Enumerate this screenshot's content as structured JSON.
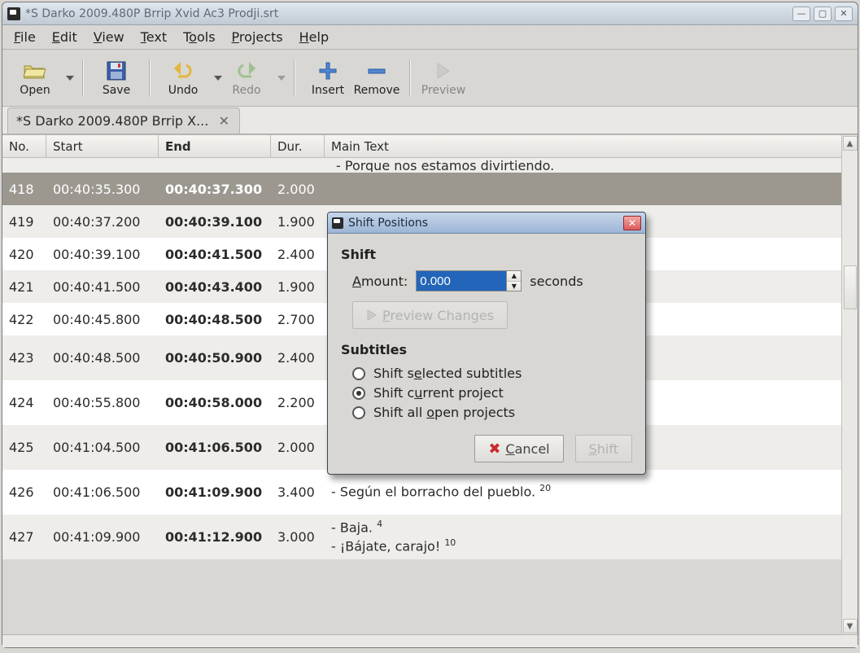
{
  "window": {
    "title": "*S Darko 2009.480P Brrip Xvid Ac3 Prodji.srt"
  },
  "menubar": [
    "File",
    "Edit",
    "View",
    "Text",
    "Tools",
    "Projects",
    "Help"
  ],
  "toolbar": {
    "open": "Open",
    "save": "Save",
    "undo": "Undo",
    "redo": "Redo",
    "insert": "Insert",
    "remove": "Remove",
    "preview": "Preview"
  },
  "doc_tab": {
    "label": "*S Darko 2009.480P Brrip X..."
  },
  "columns": {
    "no": "No.",
    "start": "Start",
    "end": "End",
    "dur": "Dur.",
    "main": "Main Text"
  },
  "cutoff_text": "- Porque nos estamos divirtiendo.",
  "rows": [
    {
      "no": "418",
      "start": "00:40:35.300",
      "end": "00:40:37.300",
      "dur": "2.000",
      "text": "",
      "selected": true
    },
    {
      "no": "419",
      "start": "00:40:37.200",
      "end": "00:40:39.100",
      "dur": "1.900",
      "text": ""
    },
    {
      "no": "420",
      "start": "00:40:39.100",
      "end": "00:40:41.500",
      "dur": "2.400",
      "text": ""
    },
    {
      "no": "421",
      "start": "00:40:41.500",
      "end": "00:40:43.400",
      "dur": "1.900",
      "text": ""
    },
    {
      "no": "422",
      "start": "00:40:45.800",
      "end": "00:40:48.500",
      "dur": "2.700",
      "text": ""
    },
    {
      "no": "423",
      "start": "00:40:48.500",
      "end": "00:40:50.900",
      "dur": "2.400",
      "text": ""
    },
    {
      "no": "424",
      "start": "00:40:55.800",
      "end": "00:40:58.000",
      "dur": "2.200",
      "text": ""
    },
    {
      "no": "425",
      "start": "00:41:04.500",
      "end": "00:41:06.500",
      "dur": "2.000",
      "text": ""
    },
    {
      "no": "426",
      "start": "00:41:06.500",
      "end": "00:41:09.900",
      "dur": "3.400",
      "text": "- Según el borracho del pueblo. 20"
    },
    {
      "no": "427",
      "start": "00:41:09.900",
      "end": "00:41:12.900",
      "dur": "3.000",
      "text": "- Baja. 4\n- ¡Bájate, carajo! 10"
    }
  ],
  "dialog": {
    "title": "Shift Positions",
    "section_shift": "Shift",
    "amount_label": "Amount:",
    "amount_value": "0.000",
    "amount_unit": "seconds",
    "preview_btn": "Preview Changes",
    "section_subs": "Subtitles",
    "opt_selected": "Shift selected subtitles",
    "opt_current": "Shift current project",
    "opt_all": "Shift all open projects",
    "cancel": "Cancel",
    "shift": "Shift"
  }
}
